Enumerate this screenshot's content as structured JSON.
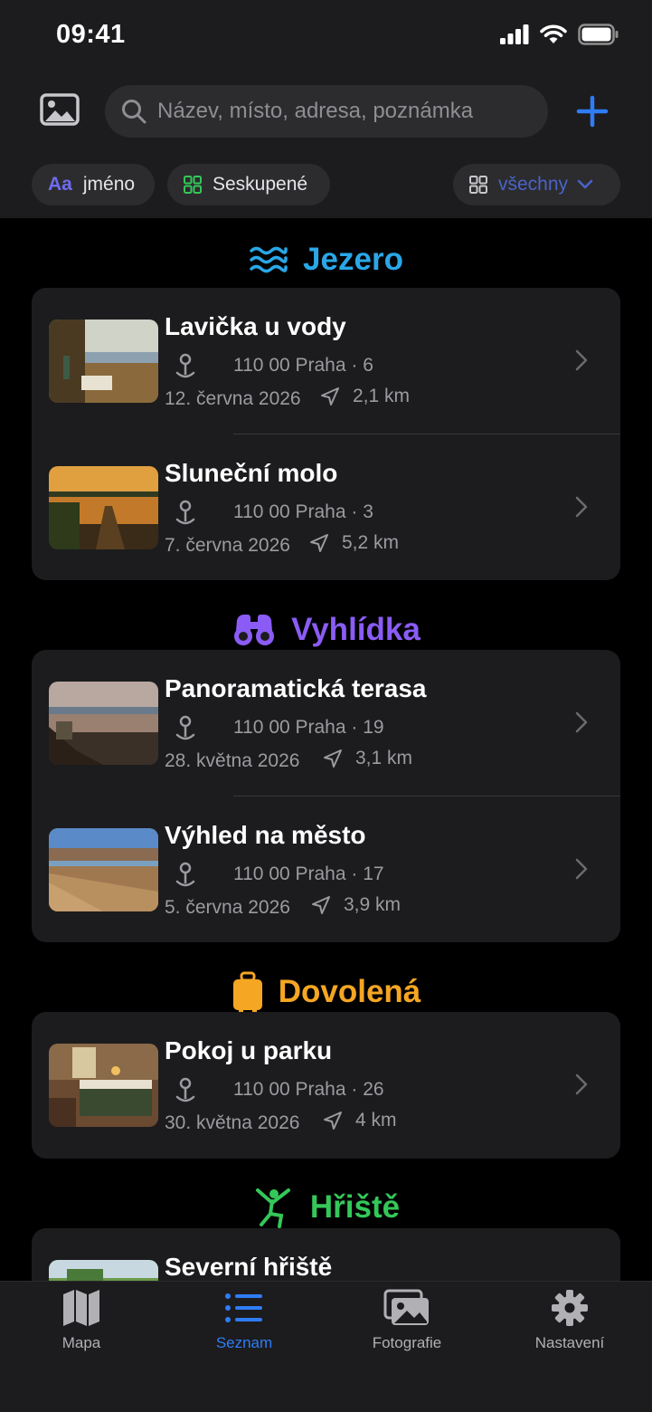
{
  "status_bar": {
    "time": "09:41"
  },
  "search": {
    "placeholder": "Název, místo, adresa, poznámka"
  },
  "chips": {
    "sort_prefix": "Aa",
    "sort_label": "jméno",
    "group_label": "Seskupené",
    "filter_label": "všechny"
  },
  "sections": [
    {
      "title": "Jezero",
      "color": "#2aa7e8",
      "icon": "water-waves-icon",
      "items": [
        {
          "title": "Lavička u vody",
          "address": "110 00 Praha · 6",
          "date": "12. června 2026",
          "distance": "2,1 km"
        },
        {
          "title": "Sluneční molo",
          "address": "110 00 Praha · 3",
          "date": "7. června 2026",
          "distance": "5,2 km"
        }
      ]
    },
    {
      "title": "Vyhlídka",
      "color": "#8a5cf5",
      "icon": "binoculars-icon",
      "items": [
        {
          "title": "Panoramatická terasa",
          "address": "110 00 Praha · 19",
          "date": "28. května 2026",
          "distance": "3,1 km"
        },
        {
          "title": "Výhled na město",
          "address": "110 00 Praha · 17",
          "date": "5. června 2026",
          "distance": "3,9 km"
        }
      ]
    },
    {
      "title": "Dovolená",
      "color": "#f5a623",
      "icon": "suitcase-icon",
      "items": [
        {
          "title": "Pokoj u parku",
          "address": "110 00 Praha · 26",
          "date": "30. května 2026",
          "distance": "4 km"
        }
      ]
    },
    {
      "title": "Hřiště",
      "color": "#34c759",
      "icon": "playground-figure-icon",
      "items": [
        {
          "title": "Severní hřiště"
        }
      ]
    }
  ],
  "tabbar": {
    "tabs": [
      {
        "label": "Mapa",
        "icon": "map-icon"
      },
      {
        "label": "Seznam",
        "icon": "list-icon",
        "active": true
      },
      {
        "label": "Fotografie",
        "icon": "photos-icon"
      },
      {
        "label": "Nastavení",
        "icon": "gear-icon"
      }
    ]
  }
}
